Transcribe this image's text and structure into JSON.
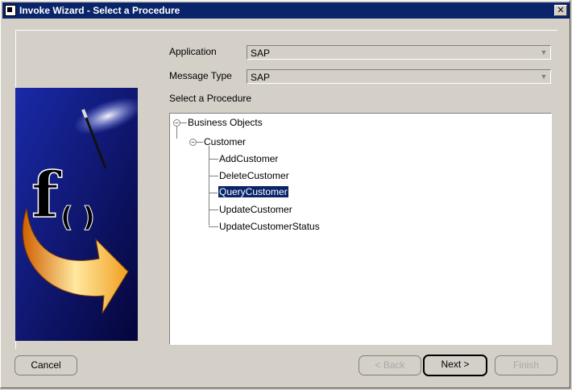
{
  "window": {
    "title": "Invoke Wizard - Select a Procedure",
    "close_glyph": "✕"
  },
  "form": {
    "application_label": "Application",
    "application_value": "SAP",
    "message_type_label": "Message Type",
    "message_type_value": "SAP",
    "procedure_label": "Select a Procedure"
  },
  "tree": {
    "root": "Business Objects",
    "group": "Customer",
    "items": [
      "AddCustomer",
      "DeleteCustomer",
      "QueryCustomer",
      "UpdateCustomer",
      "UpdateCustomerStatus"
    ],
    "selected": "QueryCustomer"
  },
  "buttons": {
    "cancel": "Cancel",
    "back": "< Back",
    "next": "Next >",
    "finish": "Finish"
  },
  "graphic": {
    "letter": "f",
    "parens": "( )"
  },
  "colors": {
    "title_bar": "#0a246a",
    "selection": "#0a246a",
    "graphic_bg": "#0c0c6e",
    "arrow": "#f0a020"
  }
}
